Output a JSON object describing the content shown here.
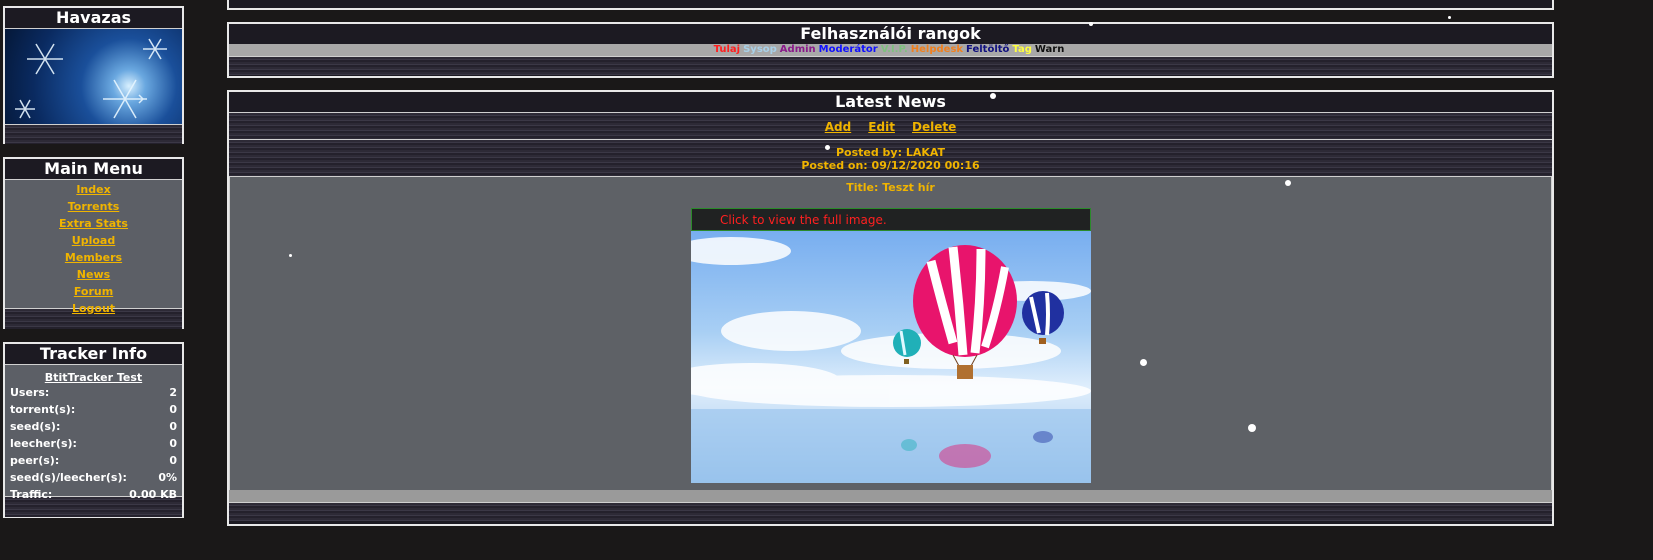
{
  "sidebar": {
    "havazas": {
      "title": "Havazas"
    },
    "main_menu": {
      "title": "Main Menu",
      "items": [
        "Index",
        "Torrents",
        "Extra Stats",
        "Upload",
        "Members",
        "News",
        "Forum",
        "Logout"
      ]
    },
    "tracker_info": {
      "title": "Tracker Info",
      "site_name": "BtitTracker Test",
      "rows": [
        {
          "label": "Users:",
          "value": "2"
        },
        {
          "label": "torrent(s):",
          "value": "0"
        },
        {
          "label": "seed(s):",
          "value": "0"
        },
        {
          "label": "leecher(s):",
          "value": "0"
        },
        {
          "label": "peer(s):",
          "value": "0"
        },
        {
          "label": "seed(s)/leecher(s):",
          "value": "0%"
        },
        {
          "label": "Traffic:",
          "value": "0.00 KB"
        }
      ]
    }
  },
  "ranks": {
    "title": "Felhasználói rangok",
    "items": [
      {
        "label": "Tulaj",
        "color": "#ff2020"
      },
      {
        "label": "Sysop",
        "color": "#a8d0e8"
      },
      {
        "label": "Admin",
        "color": "#8a1a8a"
      },
      {
        "label": "Moderátor",
        "color": "#1010ff"
      },
      {
        "label": "V.I.P.",
        "color": "#80c080"
      },
      {
        "label": "Helpdesk",
        "color": "#f08020"
      },
      {
        "label": "Feltöltő",
        "color": "#101080"
      },
      {
        "label": "Tag",
        "color": "#ffff40"
      },
      {
        "label": "Warn",
        "color": "#101010"
      }
    ]
  },
  "news": {
    "title": "Latest News",
    "actions": {
      "add": "Add",
      "edit": "Edit",
      "delete": "Delete"
    },
    "posted_by": "Posted by: LAKAT",
    "posted_on": "Posted on: 09/12/2020 00:16",
    "post_title": "Title: Teszt hír",
    "image_notice": "Click to view the full image."
  }
}
